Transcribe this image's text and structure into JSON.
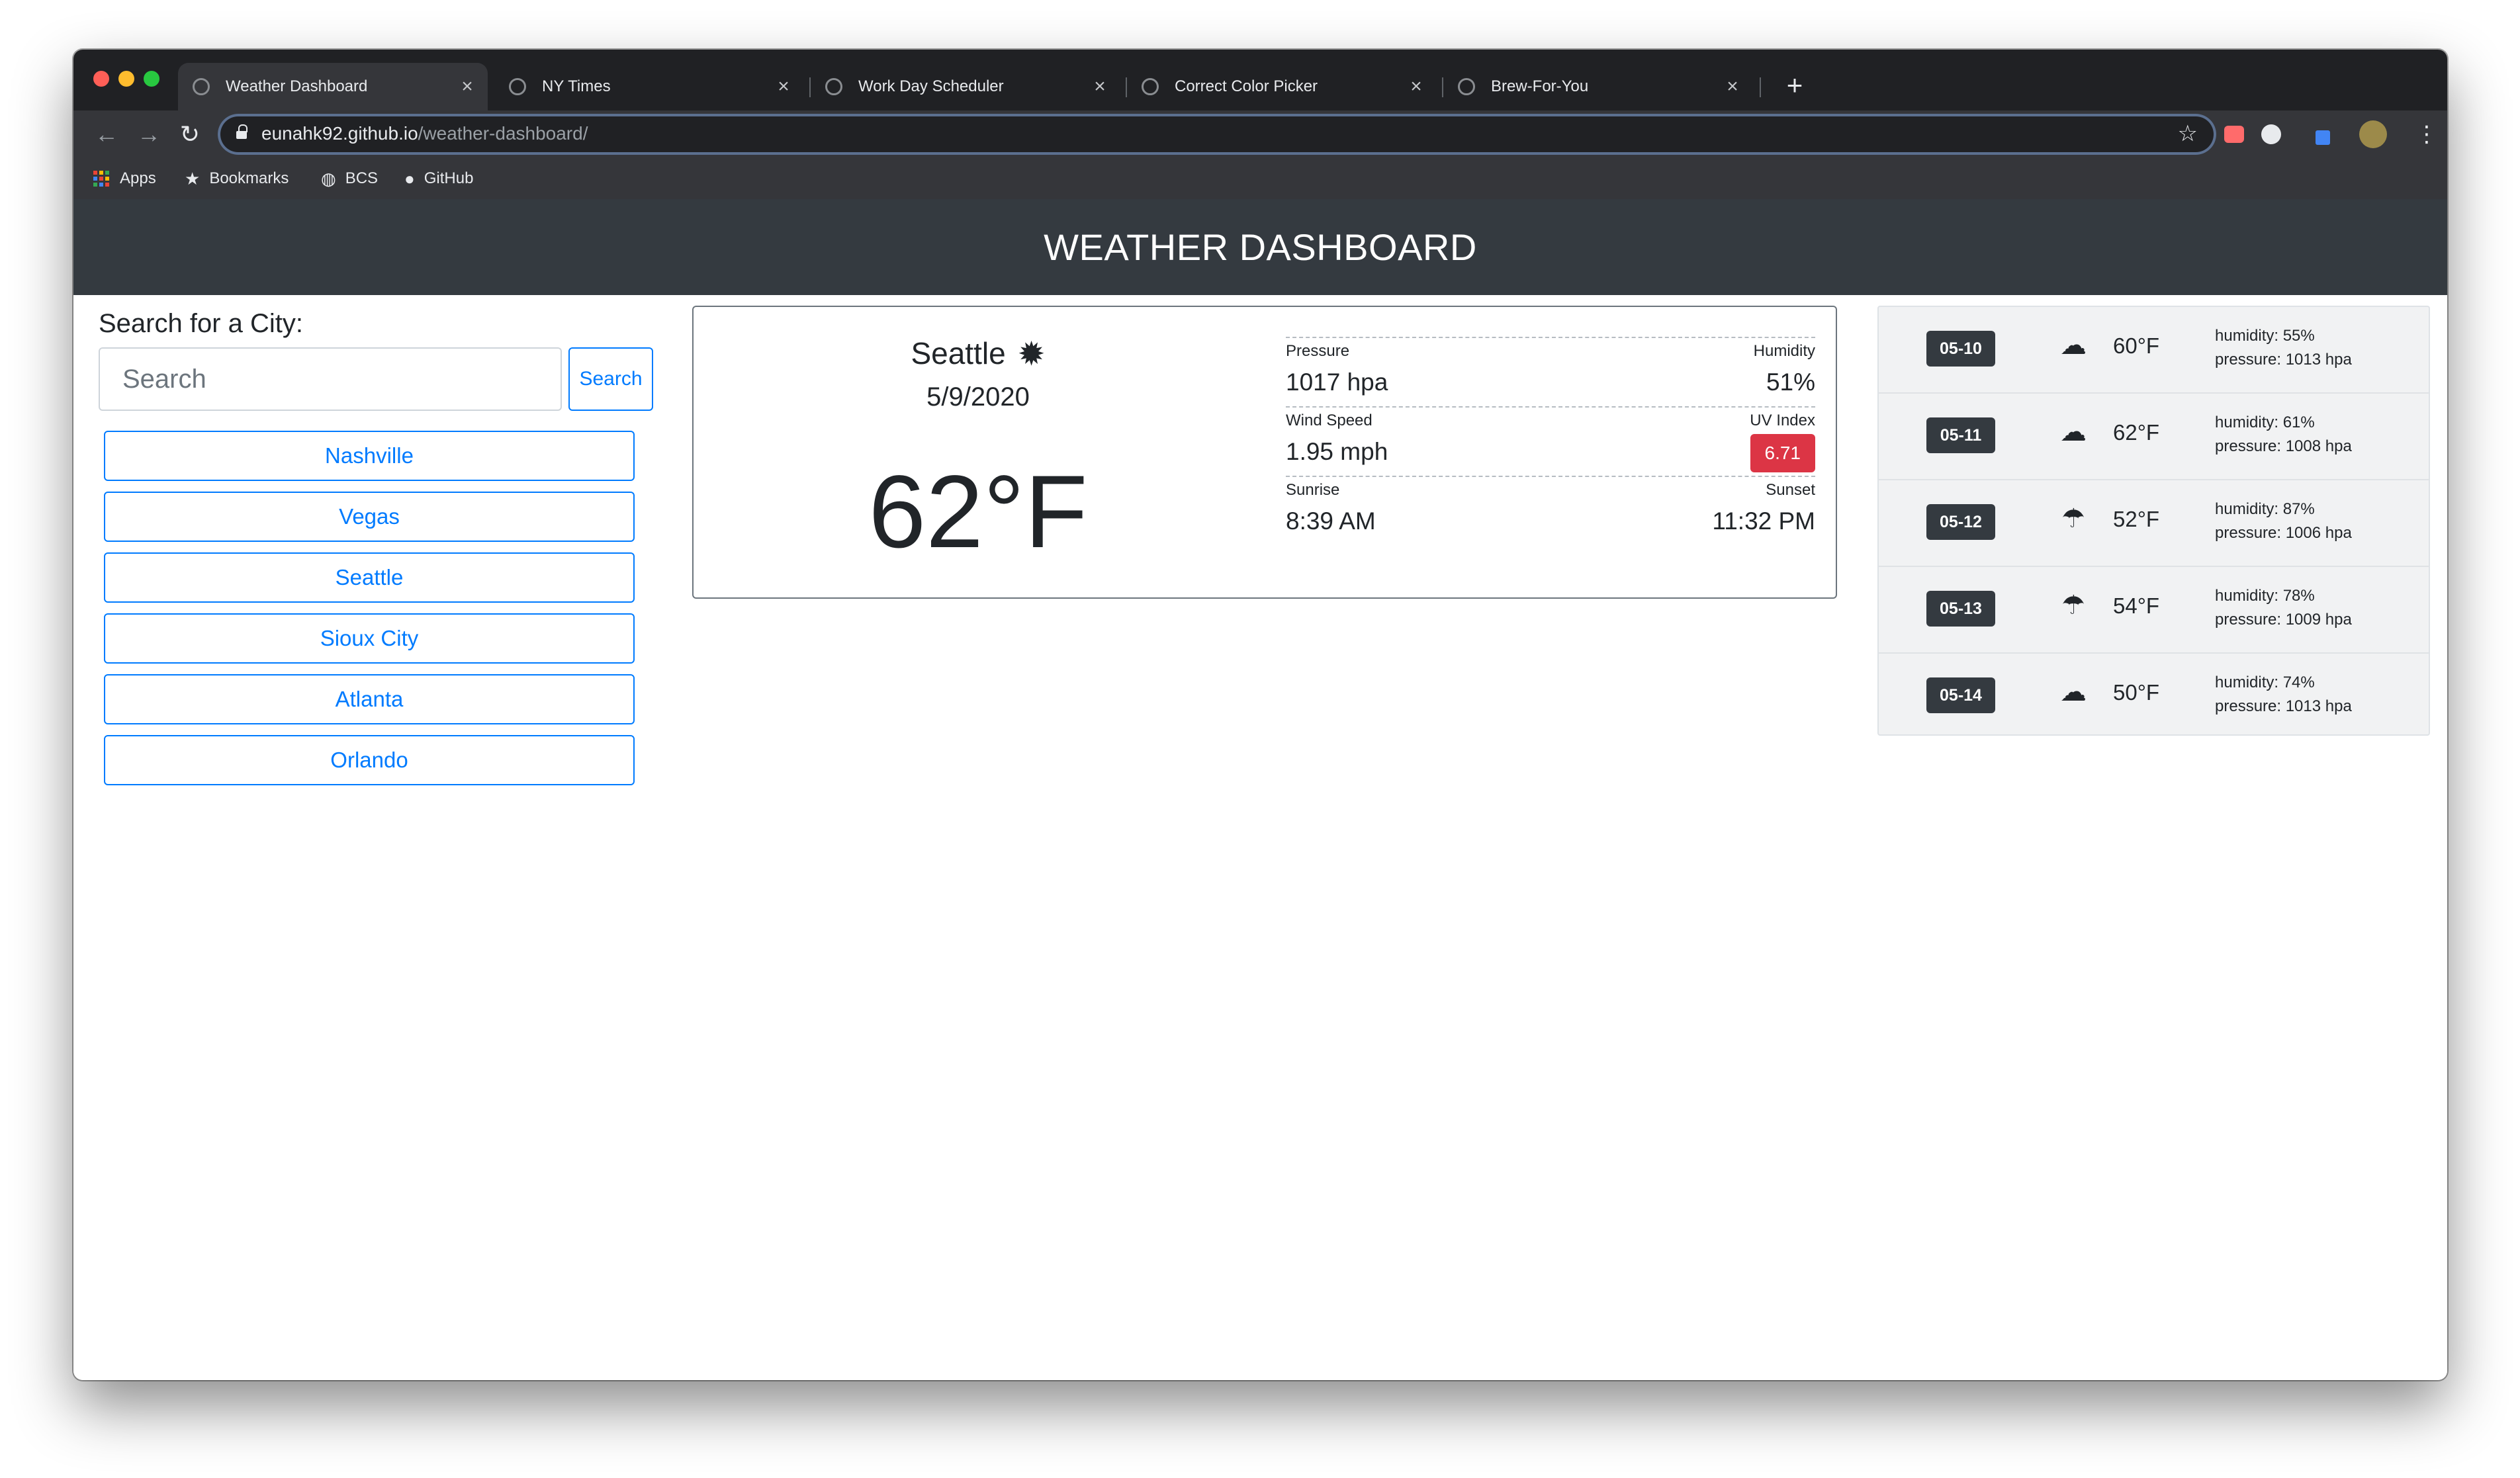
{
  "browser": {
    "tabs": [
      {
        "label": "Weather Dashboard",
        "active": true
      },
      {
        "label": "NY Times",
        "active": false
      },
      {
        "label": "Work Day Scheduler",
        "active": false
      },
      {
        "label": "Correct Color Picker",
        "active": false
      },
      {
        "label": "Brew-For-You",
        "active": false
      }
    ],
    "new_tab_symbol": "+",
    "close_symbol": "×",
    "url_host": "eunahk92.github.io",
    "url_path": "/weather-dashboard/",
    "bookmarks": [
      {
        "label": "Apps",
        "icon": "apps-grid-icon"
      },
      {
        "label": "Bookmarks",
        "icon": "star-icon"
      },
      {
        "label": "BCS",
        "icon": "globe-icon"
      },
      {
        "label": "GitHub",
        "icon": "github-icon"
      }
    ]
  },
  "header": {
    "title": "WEATHER DASHBOARD"
  },
  "sidebar": {
    "title": "Search for a City:",
    "search_placeholder": "Search",
    "search_button": "Search",
    "cities": [
      "Nashville",
      "Vegas",
      "Seattle",
      "Sioux City",
      "Atlanta",
      "Orlando"
    ]
  },
  "current": {
    "city": "Seattle",
    "icon": "sun-icon",
    "date": "5/9/2020",
    "temperature": "62°F",
    "pressure_label": "Pressure",
    "pressure": "1017 hpa",
    "humidity_label": "Humidity",
    "humidity": "51%",
    "wind_label": "Wind Speed",
    "wind": "1.95 mph",
    "uv_label": "UV Index",
    "uv": "6.71",
    "sunrise_label": "Sunrise",
    "sunrise": "8:39 AM",
    "sunset_label": "Sunset",
    "sunset": "11:32 PM"
  },
  "forecast": [
    {
      "date": "05-10",
      "icon": "partly-cloudy-icon",
      "temp": "60°F",
      "humidity": "humidity: 55%",
      "pressure": "pressure: 1013 hpa"
    },
    {
      "date": "05-11",
      "icon": "partly-cloudy-icon",
      "temp": "62°F",
      "humidity": "humidity: 61%",
      "pressure": "pressure: 1008 hpa"
    },
    {
      "date": "05-12",
      "icon": "rain-cloud-icon",
      "temp": "52°F",
      "humidity": "humidity: 87%",
      "pressure": "pressure: 1006 hpa"
    },
    {
      "date": "05-13",
      "icon": "rain-cloud-icon",
      "temp": "54°F",
      "humidity": "humidity: 78%",
      "pressure": "pressure: 1009 hpa"
    },
    {
      "date": "05-14",
      "icon": "partly-cloudy-icon",
      "temp": "50°F",
      "humidity": "humidity: 74%",
      "pressure": "pressure: 1013 hpa"
    }
  ],
  "colors": {
    "header_bg": "#343a40",
    "primary": "#007bff",
    "uv_badge": "#dc3545",
    "browser_dark": "#202124"
  }
}
